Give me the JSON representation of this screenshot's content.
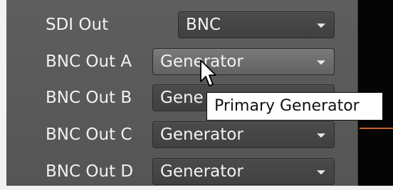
{
  "settings": {
    "rows": [
      {
        "label": "SDI Out",
        "value": "BNC"
      },
      {
        "label": "BNC Out A",
        "value": "Generator"
      },
      {
        "label": "BNC Out B",
        "value": "Gene"
      },
      {
        "label": "BNC Out C",
        "value": "Generator"
      },
      {
        "label": "BNC Out D",
        "value": "Generator"
      }
    ]
  },
  "tooltip": {
    "text": "Primary Generator"
  },
  "colors": {
    "panel": "#5a5a5a",
    "combo": "#454545",
    "combo_highlight": "#6e6e6e",
    "accent_line": "#c5652a"
  },
  "icons": {
    "cursor": "mouse-pointer-icon",
    "dropdown": "chevron-down-icon"
  }
}
